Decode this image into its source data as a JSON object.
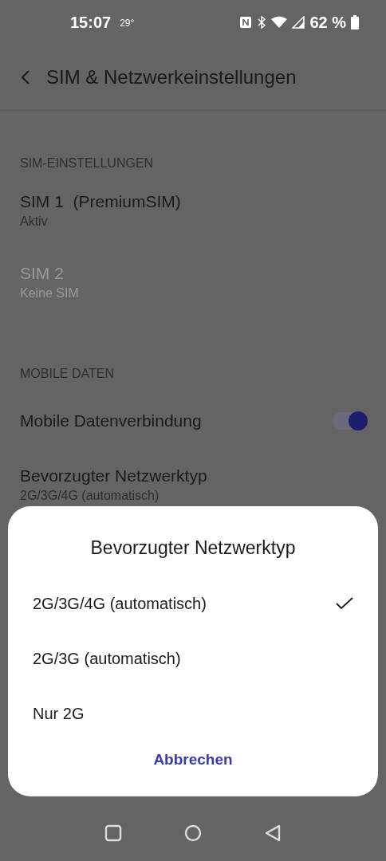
{
  "status_bar": {
    "time": "15:07",
    "temperature": "29°",
    "battery": "62 %"
  },
  "header": {
    "title": "SIM & Netzwerkeinstellungen"
  },
  "sections": [
    {
      "title": "SIM-EINSTELLUNGEN",
      "items": [
        {
          "kind": "item",
          "title": "SIM 1  (PremiumSIM)",
          "subtitle": "Aktiv",
          "disabled": false
        },
        {
          "kind": "item",
          "title": "SIM 2",
          "subtitle": "Keine SIM",
          "disabled": true
        }
      ]
    },
    {
      "title": "MOBILE DATEN",
      "items": [
        {
          "kind": "toggle",
          "title": "Mobile Datenverbindung",
          "on": true
        },
        {
          "kind": "item",
          "title": "Bevorzugter Netzwerktyp",
          "subtitle": "2G/3G/4G (automatisch)",
          "disabled": false
        }
      ]
    }
  ],
  "dialog": {
    "title": "Bevorzugter Netzwerktyp",
    "options": [
      {
        "label": "2G/3G/4G (automatisch)",
        "selected": true
      },
      {
        "label": "2G/3G (automatisch)",
        "selected": false
      },
      {
        "label": "Nur 2G",
        "selected": false
      }
    ],
    "cancel": "Abbrechen"
  }
}
